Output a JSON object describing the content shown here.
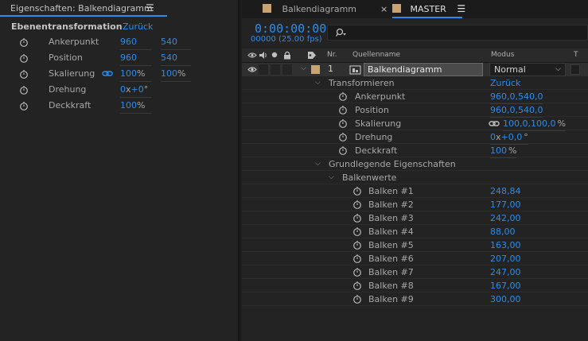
{
  "left_panel": {
    "title": "Eigenschaften: Balkendiagramm",
    "section_label": "Ebenentransformation",
    "reset_label": "Zurück",
    "props": [
      {
        "label": "Ankerpunkt",
        "v1": "960",
        "v2": "540"
      },
      {
        "label": "Position",
        "v1": "960",
        "v2": "540"
      },
      {
        "label": "Skalierung",
        "v1": "100",
        "v1_unit": "%",
        "v2": "100",
        "v2_unit": "%"
      },
      {
        "label": "Drehung",
        "v1": "0",
        "v1_mid": "x",
        "v2": "+0",
        "v2_unit": "°"
      },
      {
        "label": "Deckkraft",
        "v1": "100",
        "v1_unit": "%"
      }
    ]
  },
  "right_panel": {
    "tabs": [
      {
        "label": "Balkendiagramm"
      },
      {
        "label": "MASTER"
      }
    ],
    "timecode": "0:00:00:00",
    "fps": "00000 (25.00 fps)",
    "columns": {
      "nr": "Nr.",
      "source": "Quellenname",
      "mode": "Modus",
      "t": "T"
    },
    "layer": {
      "nr": "1",
      "name": "Balkendiagramm",
      "mode": "Normal"
    },
    "transform": {
      "group_label": "Transformieren",
      "reset_label": "Zurück",
      "props": [
        {
          "label": "Ankerpunkt",
          "value": "960,0,540,0"
        },
        {
          "label": "Position",
          "value": "960,0,540,0"
        },
        {
          "label": "Skalierung",
          "value": "100,0,100,0",
          "unit": "%"
        },
        {
          "label": "Drehung",
          "value": "0",
          "mid": "x",
          "value2": "+0,0",
          "unit": "°"
        },
        {
          "label": "Deckkraft",
          "value": "100",
          "unit": "%"
        }
      ]
    },
    "essential": {
      "group_label": "Grundlegende Eigenschaften",
      "sub_label": "Balkenwerte",
      "bars": [
        {
          "label": "Balken #1",
          "value": "248,84"
        },
        {
          "label": "Balken #2",
          "value": "177,00"
        },
        {
          "label": "Balken #3",
          "value": "242,00"
        },
        {
          "label": "Balken #4",
          "value": "88,00"
        },
        {
          "label": "Balken #5",
          "value": "163,00"
        },
        {
          "label": "Balken #6",
          "value": "207,00"
        },
        {
          "label": "Balken #7",
          "value": "247,00"
        },
        {
          "label": "Balken #8",
          "value": "167,00"
        },
        {
          "label": "Balken #9",
          "value": "300,00"
        }
      ]
    }
  }
}
